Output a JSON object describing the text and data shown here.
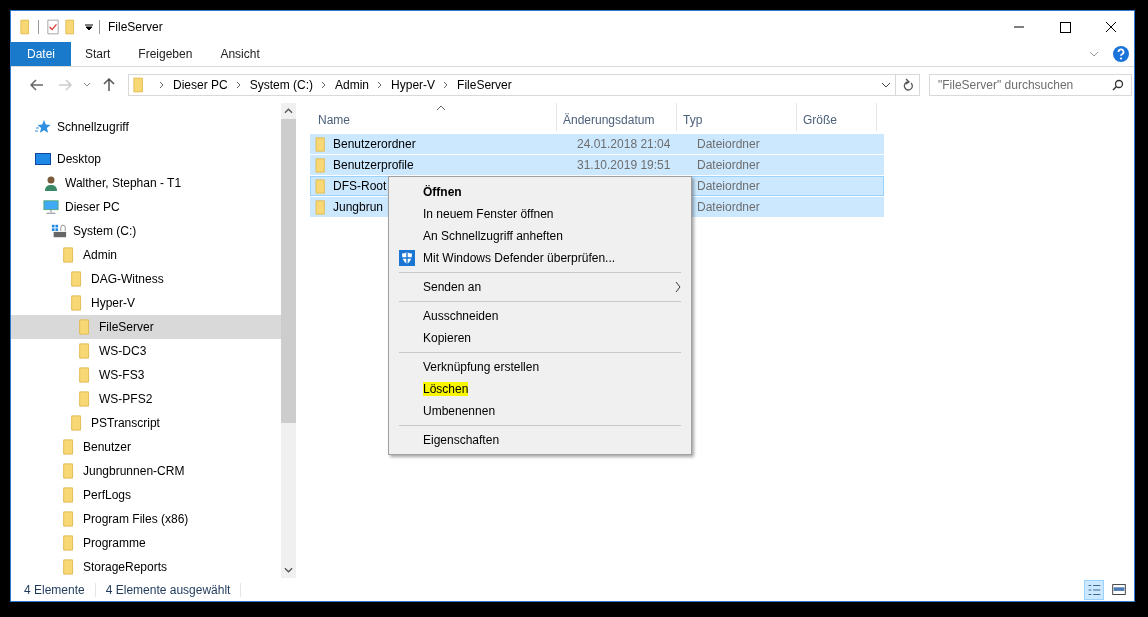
{
  "window": {
    "title": "FileServer"
  },
  "ribbon": {
    "tabs": [
      {
        "label": "Datei",
        "kind": "file"
      },
      {
        "label": "Start",
        "kind": "tab"
      },
      {
        "label": "Freigeben",
        "kind": "tab"
      },
      {
        "label": "Ansicht",
        "kind": "tab"
      }
    ]
  },
  "address_bar": {
    "crumbs": [
      "Dieser PC",
      "System (C:)",
      "Admin",
      "Hyper-V",
      "FileServer"
    ]
  },
  "search": {
    "placeholder": "\"FileServer\" durchsuchen"
  },
  "sidebar": {
    "tree": [
      {
        "label": "Schnellzugriff",
        "kind": "star",
        "selected": false
      },
      {
        "label": "Desktop",
        "kind": "desktop",
        "selected": false,
        "children": [
          {
            "label": "Walther, Stephan - T1",
            "kind": "user",
            "selected": false
          },
          {
            "label": "Dieser PC",
            "kind": "pc",
            "selected": false,
            "children": [
              {
                "label": "System (C:)",
                "kind": "drive",
                "selected": false,
                "children": [
                  {
                    "label": "Admin",
                    "kind": "folder",
                    "selected": false,
                    "children": [
                      {
                        "label": "DAG-Witness",
                        "kind": "folder",
                        "selected": false
                      },
                      {
                        "label": "Hyper-V",
                        "kind": "folder",
                        "selected": false,
                        "children": [
                          {
                            "label": "FileServer",
                            "kind": "folder",
                            "selected": true
                          },
                          {
                            "label": "WS-DC3",
                            "kind": "folder",
                            "selected": false
                          },
                          {
                            "label": "WS-FS3",
                            "kind": "folder",
                            "selected": false
                          },
                          {
                            "label": "WS-PFS2",
                            "kind": "folder",
                            "selected": false
                          }
                        ]
                      },
                      {
                        "label": "PSTranscript",
                        "kind": "folder",
                        "selected": false
                      }
                    ]
                  },
                  {
                    "label": "Benutzer",
                    "kind": "folder",
                    "selected": false
                  },
                  {
                    "label": "Jungbrunnen-CRM",
                    "kind": "folder",
                    "selected": false
                  },
                  {
                    "label": "PerfLogs",
                    "kind": "folder",
                    "selected": false
                  },
                  {
                    "label": "Program Files (x86)",
                    "kind": "folder",
                    "selected": false
                  },
                  {
                    "label": "Programme",
                    "kind": "folder",
                    "selected": false
                  },
                  {
                    "label": "StorageReports",
                    "kind": "folder",
                    "selected": false
                  }
                ]
              }
            ]
          }
        ]
      }
    ]
  },
  "file_list": {
    "columns": [
      "Name",
      "Änderungsdatum",
      "Typ",
      "Größe"
    ],
    "rows": [
      {
        "name": "Benutzerordner",
        "date": "24.01.2018 21:04",
        "type": "Dateiordner",
        "selected": true,
        "focused": false
      },
      {
        "name": "Benutzerprofile",
        "date": "31.10.2019 19:51",
        "type": "Dateiordner",
        "selected": true,
        "focused": false
      },
      {
        "name": "DFS-Root",
        "type": "Dateiordner",
        "selected": true,
        "focused": true
      },
      {
        "name": "Jungbrun",
        "type": "Dateiordner",
        "selected": true,
        "focused": false
      }
    ]
  },
  "context_menu": {
    "groups": [
      [
        {
          "label": "Öffnen",
          "kind": "default",
          "highlighted": false
        },
        {
          "label": "In neuem Fenster öffnen",
          "kind": "plain",
          "highlighted": false
        },
        {
          "label": "An Schnellzugriff anheften",
          "kind": "plain",
          "highlighted": false
        },
        {
          "label": "Mit Windows Defender überprüfen...",
          "kind": "shield",
          "highlighted": false
        }
      ],
      [
        {
          "label": "Senden an",
          "kind": "submenu",
          "highlighted": false
        }
      ],
      [
        {
          "label": "Ausschneiden",
          "kind": "plain",
          "highlighted": false
        },
        {
          "label": "Kopieren",
          "kind": "plain",
          "highlighted": false
        }
      ],
      [
        {
          "label": "Verknüpfung erstellen",
          "kind": "plain",
          "highlighted": false
        },
        {
          "label": "Löschen",
          "kind": "plain",
          "highlighted": true
        },
        {
          "label": "Umbenennen",
          "kind": "plain",
          "highlighted": false
        }
      ],
      [
        {
          "label": "Eigenschaften",
          "kind": "plain",
          "highlighted": false
        }
      ]
    ]
  },
  "status_bar": {
    "items": [
      "4 Elemente",
      "4 Elemente ausgewählt"
    ],
    "views": [
      {
        "kind": "details",
        "selected": true
      },
      {
        "kind": "preview",
        "selected": false
      }
    ]
  }
}
